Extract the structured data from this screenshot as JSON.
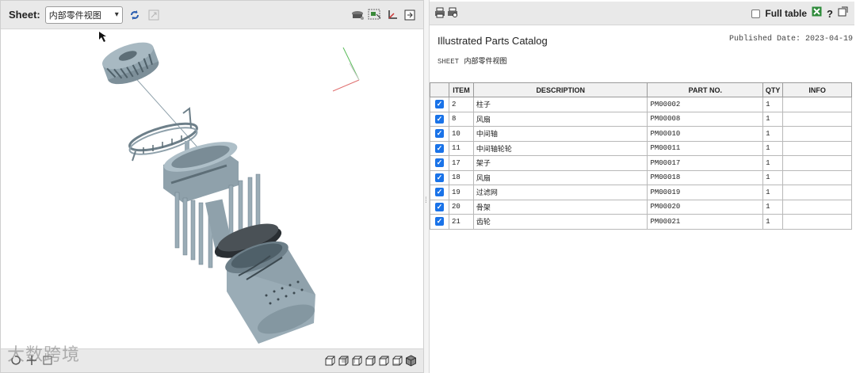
{
  "viewer": {
    "sheet_label": "Sheet:",
    "sheet_value": "内部零件视图",
    "watermark": "大数跨境",
    "toolbar_icons": [
      "refresh-icon",
      "fit-icon",
      "explode-icon",
      "select-icon",
      "axes-icon",
      "export-icon"
    ],
    "view_icons": [
      "view-front-icon",
      "view-back-icon",
      "view-left-icon",
      "view-right-icon",
      "view-top-icon",
      "view-bottom-icon",
      "view-iso-icon"
    ]
  },
  "catalog": {
    "title": "Illustrated Parts Catalog",
    "published_date": "Published Date: 2023-04-19",
    "sheet_key": "SHEET",
    "sheet_value": "内部零件视图",
    "full_table_label": "Full table",
    "help_label": "?",
    "columns": [
      "ITEM",
      "DESCRIPTION",
      "PART NO.",
      "QTY",
      "INFO"
    ],
    "rows": [
      {
        "item": "2",
        "desc": "柱子",
        "pn": "PM00002",
        "qty": "1",
        "info": ""
      },
      {
        "item": "8",
        "desc": "风扇",
        "pn": "PM00008",
        "qty": "1",
        "info": ""
      },
      {
        "item": "10",
        "desc": "中间轴",
        "pn": "PM00010",
        "qty": "1",
        "info": ""
      },
      {
        "item": "11",
        "desc": "中间轴轮轮",
        "pn": "PM00011",
        "qty": "1",
        "info": ""
      },
      {
        "item": "17",
        "desc": "架子",
        "pn": "PM00017",
        "qty": "1",
        "info": ""
      },
      {
        "item": "18",
        "desc": "风扇",
        "pn": "PM00018",
        "qty": "1",
        "info": ""
      },
      {
        "item": "19",
        "desc": "过滤网",
        "pn": "PM00019",
        "qty": "1",
        "info": ""
      },
      {
        "item": "20",
        "desc": "骨架",
        "pn": "PM00020",
        "qty": "1",
        "info": ""
      },
      {
        "item": "21",
        "desc": "齿轮",
        "pn": "PM00021",
        "qty": "1",
        "info": ""
      }
    ]
  },
  "colors": {
    "accent": "#1a73e8",
    "model": "#8fa1ab",
    "toolbar": "#e9e9e9"
  }
}
